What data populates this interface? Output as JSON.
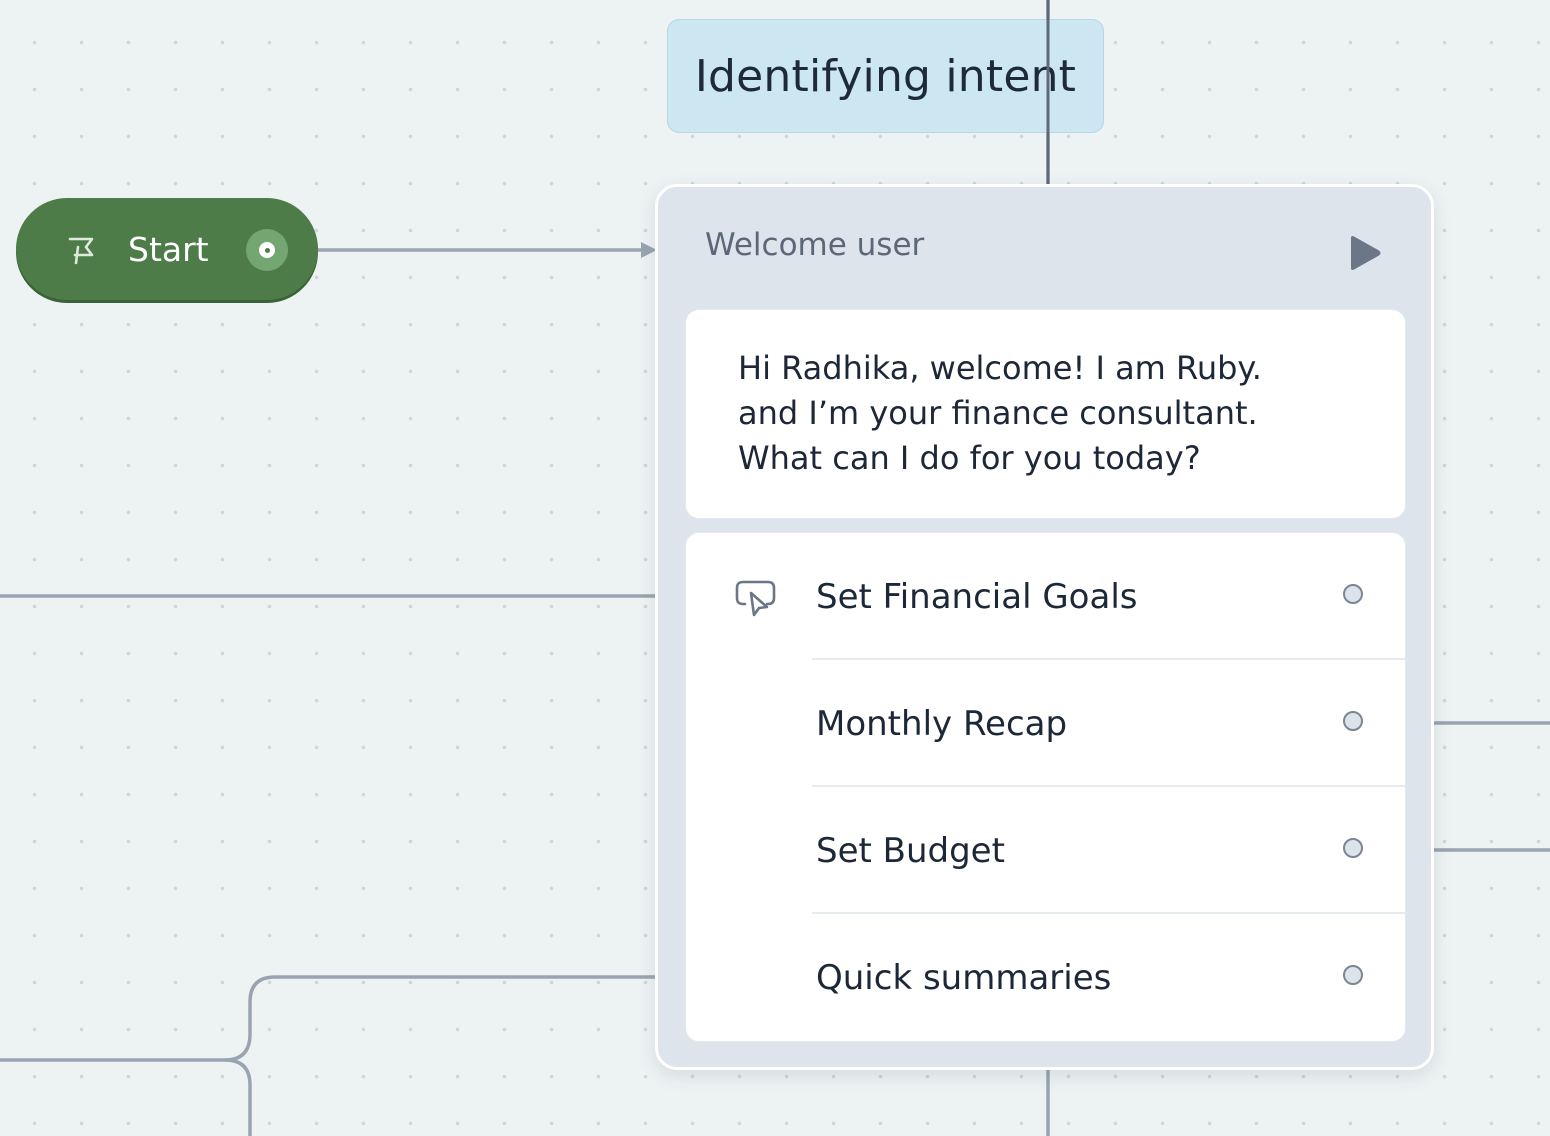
{
  "canvas": {
    "label_node": "Identifying intent",
    "start_node": {
      "label": "Start",
      "icon": "flag-icon"
    }
  },
  "card": {
    "title": "Welcome user",
    "play_icon": "play-icon",
    "message_lines": [
      "Hi Radhika, welcome! I am Ruby.",
      "and I’m your finance consultant.",
      "What can I do for you today?"
    ],
    "options_icon": "click-cursor-icon",
    "options": [
      {
        "label": "Set Financial Goals"
      },
      {
        "label": "Monthly Recap"
      },
      {
        "label": "Set Budget"
      },
      {
        "label": "Quick summaries"
      }
    ]
  },
  "colors": {
    "canvas_bg": "#edf3f3",
    "start_node": "#4d7c49",
    "label_node": "#cce6f2",
    "card_bg": "#dde4ec",
    "connector": "#9aa4b1",
    "text": "#1c2737"
  }
}
